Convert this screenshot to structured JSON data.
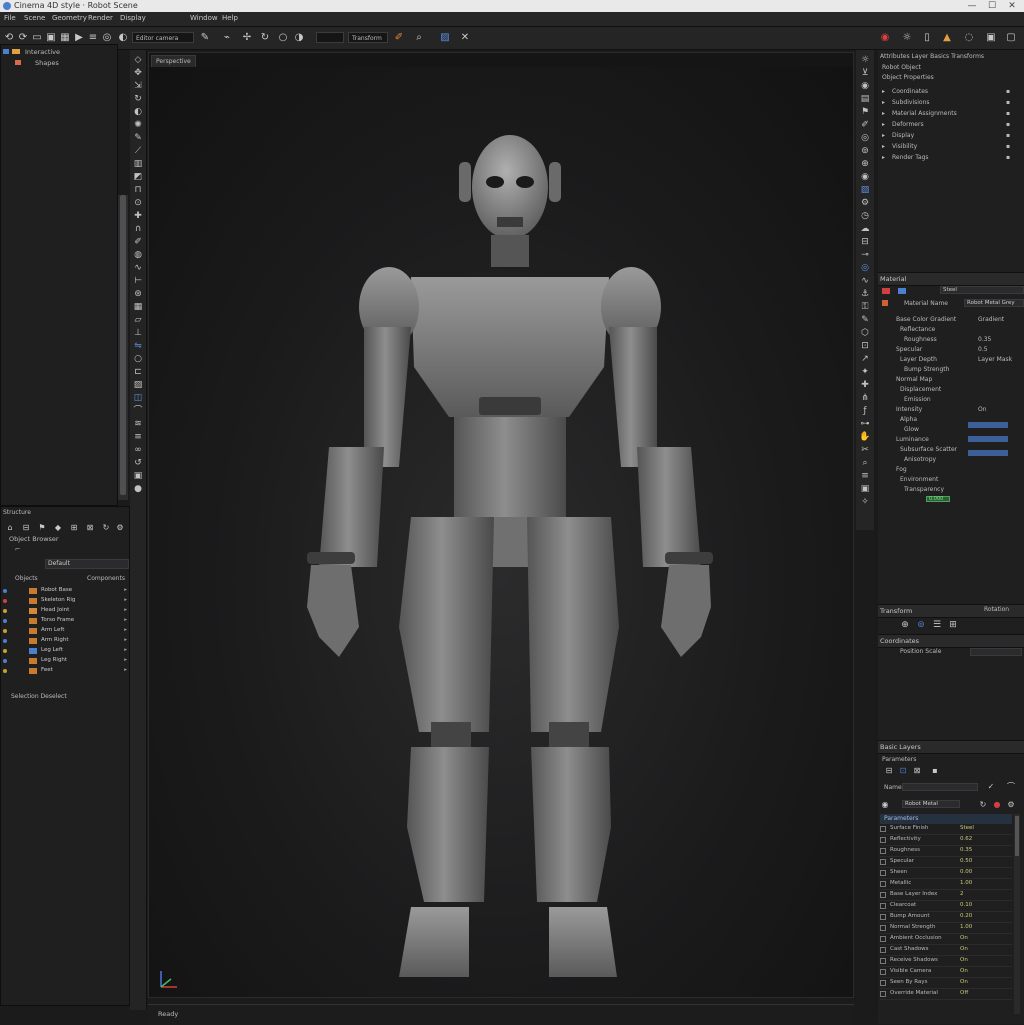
{
  "app": {
    "title": "Cinema 4D style · Robot Scene"
  },
  "window_controls": {
    "minimize": "—",
    "maximize": "☐",
    "close": "✕"
  },
  "menu": [
    "File",
    "Scene",
    "Geometry",
    "Render",
    "Display",
    "Window",
    "Help"
  ],
  "toolbar": {
    "mode_field": "Editor camera",
    "layer_field": "Transform"
  },
  "left_panel": {
    "items": [
      "Interactive",
      "Shapes"
    ]
  },
  "layers_panel": {
    "title": "Structure",
    "header": "Object Browser",
    "dropdown": "Default",
    "col_left": "Objects",
    "col_right": "Components",
    "rows": [
      {
        "label": "Robot Base",
        "color": "#c87a2e"
      },
      {
        "label": "Skeleton Rig",
        "color": "#c87a2e"
      },
      {
        "label": "Head Joint",
        "color": "#d08a3a"
      },
      {
        "label": "Torso Frame",
        "color": "#c87a2e"
      },
      {
        "label": "Arm Left",
        "color": "#c87a2e"
      },
      {
        "label": "Arm Right",
        "color": "#c87a2e"
      },
      {
        "label": "Leg Left",
        "color": "#4b7fcf"
      },
      {
        "label": "Leg Right",
        "color": "#c87a2e"
      },
      {
        "label": "Feet",
        "color": "#c87a2e"
      }
    ],
    "footer": "Selection Deselect"
  },
  "viewport": {
    "tab_label": "Perspective",
    "status_text": "Ready"
  },
  "right_panel": {
    "top_header": "Attributes  Layer  Basics  Transforms",
    "tree_title": "Robot Object",
    "tree_sub": "Object Properties",
    "tree_items": [
      "Coordinates",
      "Subdivisions",
      "Material Assignments",
      "Deformers",
      "Display",
      "Visibility",
      "Render Tags"
    ],
    "section2_title": "Material",
    "section2_field": "Steel",
    "section2_label": "Material Name",
    "section2_field2": "Robot Metal Grey",
    "props": [
      {
        "name": "Base Color Gradient",
        "value": "Gradient"
      },
      {
        "name": "Reflectance",
        "value": ""
      },
      {
        "name": "Roughness",
        "value": "0.35"
      },
      {
        "name": "Specular",
        "value": "0.5"
      },
      {
        "name": "Layer Depth",
        "value": "Layer Mask"
      },
      {
        "name": "Bump Strength",
        "value": ""
      },
      {
        "name": "Normal Map",
        "value": ""
      },
      {
        "name": "Displacement",
        "value": ""
      },
      {
        "name": "Emission",
        "value": ""
      },
      {
        "name": "Intensity",
        "value": "On"
      },
      {
        "name": "Alpha",
        "value": ""
      },
      {
        "name": "Glow",
        "value": ""
      },
      {
        "name": "Luminance",
        "value": ""
      },
      {
        "name": "Subsurface Scatter",
        "value": ""
      },
      {
        "name": "Anisotropy",
        "value": ""
      },
      {
        "name": "Fog",
        "value": ""
      },
      {
        "name": "Environment",
        "value": ""
      },
      {
        "name": "Transparency",
        "value": ""
      }
    ],
    "section3_title": "Transform",
    "section3_right": "Rotation",
    "section4_title": "Coordinates",
    "section4_sub": "Position Scale",
    "section5_title": "Basic Layers",
    "section5_sub": "Parameters",
    "section5_field": "Name",
    "section5_dropdown": "Robot Metal",
    "table_header": "Parameters",
    "table_rows": [
      {
        "name": "Surface Finish",
        "value": "Steel"
      },
      {
        "name": "Reflectivity",
        "value": "0.62"
      },
      {
        "name": "Roughness",
        "value": "0.35"
      },
      {
        "name": "Specular",
        "value": "0.50"
      },
      {
        "name": "Sheen",
        "value": "0.00"
      },
      {
        "name": "Metallic",
        "value": "1.00"
      },
      {
        "name": "Base Layer Index",
        "value": "2"
      },
      {
        "name": "Clearcoat",
        "value": "0.10"
      },
      {
        "name": "Bump Amount",
        "value": "0.20"
      },
      {
        "name": "Normal Strength",
        "value": "1.00"
      },
      {
        "name": "Ambient Occlusion",
        "value": "On"
      },
      {
        "name": "Cast Shadows",
        "value": "On"
      },
      {
        "name": "Receive Shadows",
        "value": "On"
      },
      {
        "name": "Visible Camera",
        "value": "On"
      },
      {
        "name": "Seen By Rays",
        "value": "On"
      },
      {
        "name": "Override Material",
        "value": "Off"
      }
    ],
    "green_value": "0.000"
  }
}
